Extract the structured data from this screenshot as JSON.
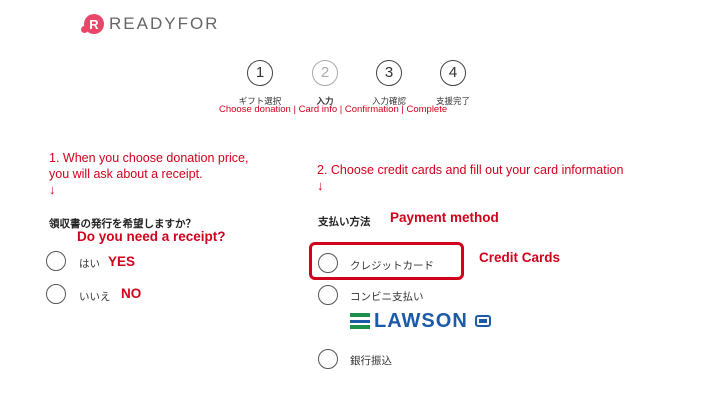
{
  "header": {
    "logo_mark": "R",
    "logo_text": "READYFOR"
  },
  "steps": [
    {
      "number": "1",
      "label": "ギフト選択",
      "active": true
    },
    {
      "number": "2",
      "label": "入力",
      "active": false
    },
    {
      "number": "3",
      "label": "入力確認",
      "active": true
    },
    {
      "number": "4",
      "label": "支援完了",
      "active": true
    }
  ],
  "steps_english": "Choose donation | Card info | Confirmation | Complete",
  "notes": {
    "left_line1": "1. When you choose donation price,",
    "left_line2": "you will ask about a receipt.",
    "right": "2. Choose credit cards and fill out your card information",
    "arrow": "↓"
  },
  "receipt": {
    "question": "領収書の発行を希望しますか？",
    "question_en": "Do you need a receipt?",
    "options": [
      {
        "label": "はい",
        "label_en": "YES"
      },
      {
        "label": "いいえ",
        "label_en": "NO"
      }
    ]
  },
  "payment": {
    "title": "支払い方法",
    "title_en": "Payment method",
    "options": [
      {
        "label": "クレジットカード",
        "label_en": "Credit Cards"
      },
      {
        "label": "コンビニ支払い"
      },
      {
        "label": "銀行振込"
      }
    ],
    "convenience_store_logo": "LAWSON"
  },
  "colors": {
    "annotation_red": "#d0021b",
    "brand_pink": "#e8476a",
    "lawson_blue": "#1b5aa8"
  }
}
